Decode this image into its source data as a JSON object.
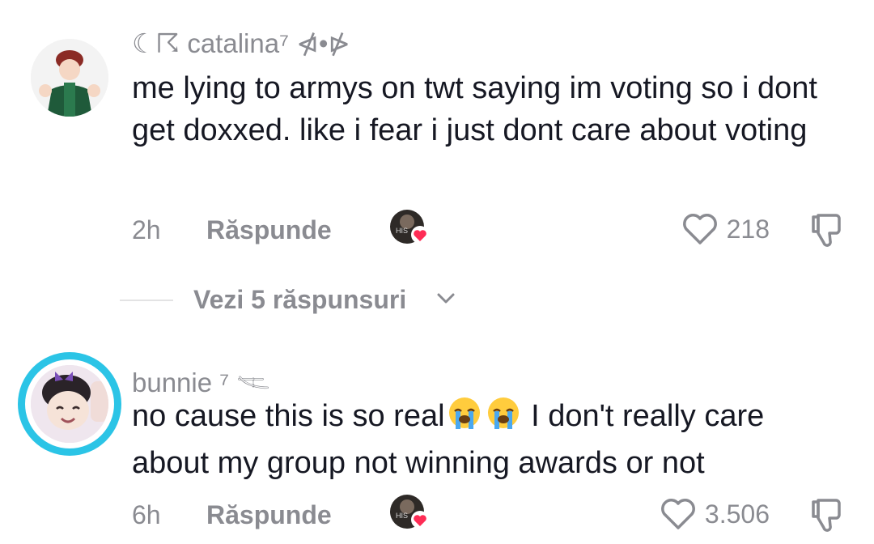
{
  "comments": [
    {
      "username": "☾☈ catalina⁷ ⋪•⋫",
      "text": "me lying to armys on twt saying im voting so i dont get doxxed. like i fear i just dont care about voting",
      "time": "2h",
      "reply_label": "Răspunde",
      "likes": "218"
    },
    {
      "username": "bunnie ⁷ 𓌻",
      "text_before": "no cause this is so real",
      "emojis": [
        "loudly-crying-face",
        "loudly-crying-face"
      ],
      "text_after": " I don't really care about my group not winning awards or not",
      "time": "6h",
      "reply_label": "Răspunde",
      "likes": "3.506"
    }
  ],
  "view_replies": {
    "label": "Vezi 5 răspunsuri"
  },
  "colors": {
    "ring": "#2bc4e6",
    "heart_badge": "#fe2c55",
    "muted": "#8a8b91",
    "text": "#161823"
  }
}
